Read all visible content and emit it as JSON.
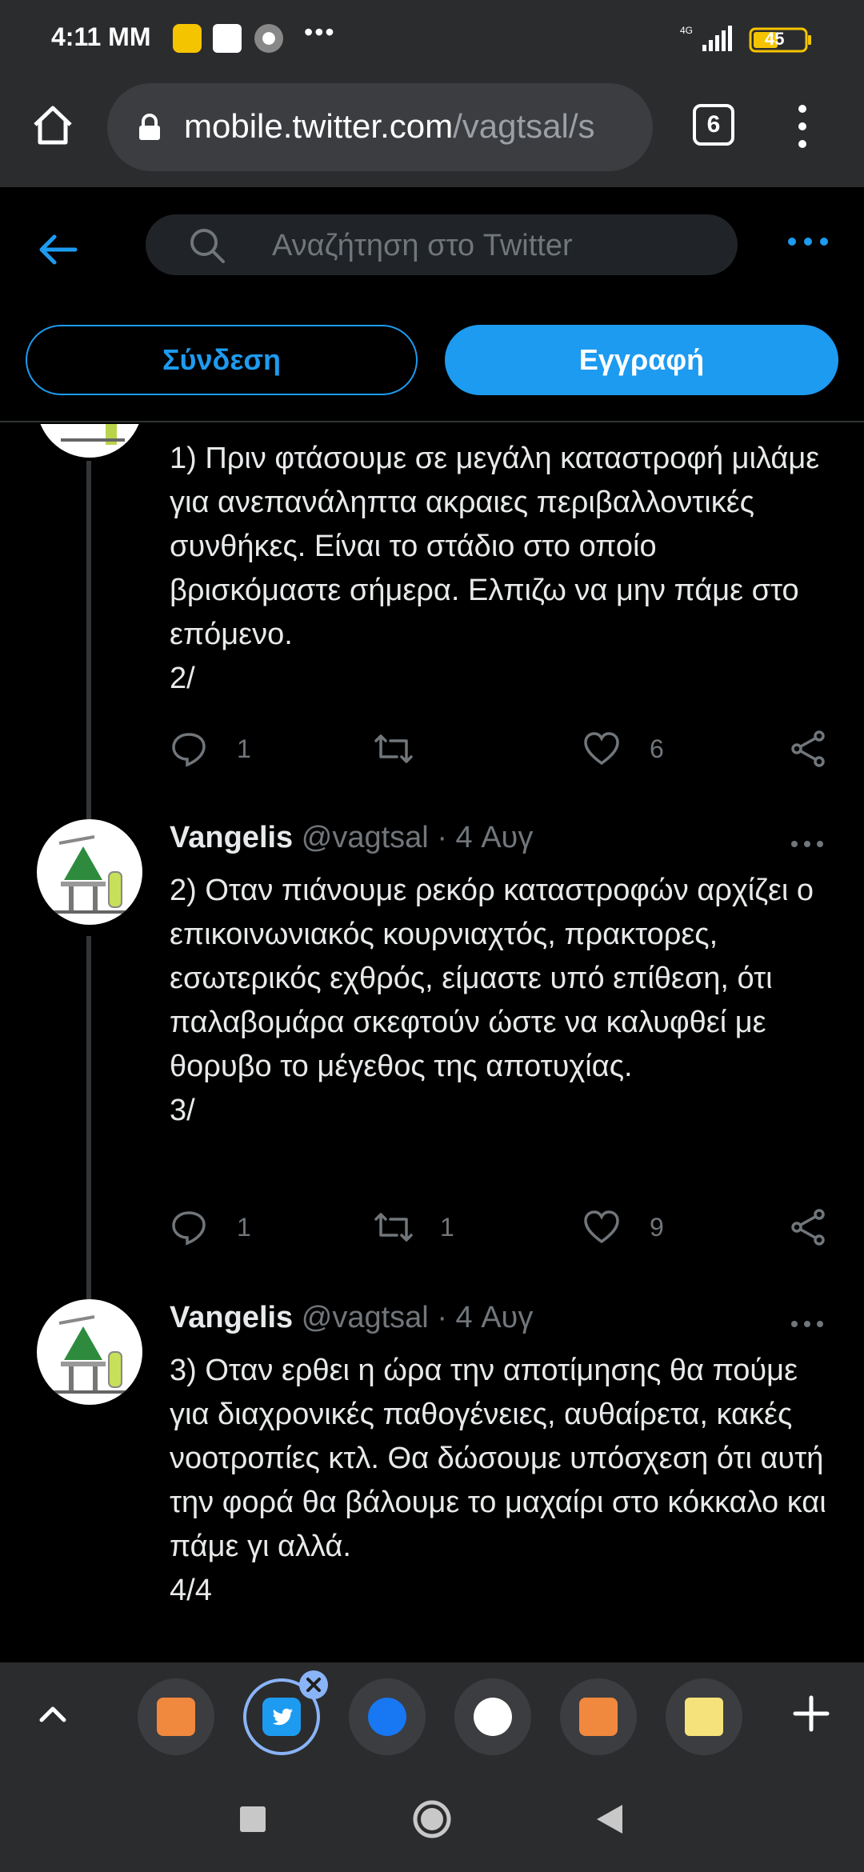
{
  "status_bar": {
    "time": "4:11 ΜΜ",
    "battery": "45",
    "network": "4G"
  },
  "browser": {
    "url_host": "mobile.twitter.com",
    "url_path": "/vagtsal/s",
    "tab_count": "6"
  },
  "twitter_header": {
    "search_placeholder": "Αναζήτηση στο Twitter",
    "login_label": "Σύνδεση",
    "signup_label": "Εγγραφή",
    "accent_color": "#1d9bf0"
  },
  "tweets": [
    {
      "text": "1) Πριν φτάσουμε σε μεγάλη καταστροφή μιλάμε για ανεπανάληπτα ακραιες περιβαλλοντικές συνθήκες. Είναι το στάδιο στο οποίο βρισκόμαστε σήμερα. Ελπιζω να μην πάμε στο επόμενο.\n2/",
      "replies": "1",
      "retweets": "",
      "likes": "6"
    },
    {
      "name": "Vangelis",
      "handle": "@vagtsal",
      "date": "· 4 Αυγ",
      "text": "2) Οταν πιάνουμε ρεκόρ καταστροφών αρχίζει ο επικοινωνιακός κουρνιαχτός, πρακτορες, εσωτερικός εχθρός, είμαστε υπό επίθεση, ότι παλαβομάρα σκεφτούν ώστε να καλυφθεί με θορυβο το μέγεθος της αποτυχίας.\n3/",
      "replies": "1",
      "retweets": "1",
      "likes": "9"
    },
    {
      "name": "Vangelis",
      "handle": "@vagtsal",
      "date": "· 4 Αυγ",
      "text": "3) Οταν ερθει η ώρα την αποτίμησης θα πούμε για διαχρονικές παθογένειες, αυθαίρετα, κακές νοοτροπίες κτλ. Θα δώσουμε υπόσχεση ότι αυτή την φορά θα βάλουμε το μαχαίρι στο κόκκαλο και πάμε γι αλλά.\n4/4"
    }
  ],
  "tab_strip": {
    "tabs": [
      {
        "icon": "ph-icon",
        "color": "#f0883e"
      },
      {
        "icon": "twitter-icon",
        "color": "#1d9bf0"
      },
      {
        "icon": "facebook-icon",
        "color": "#1877f2"
      },
      {
        "icon": "wikipedia-icon",
        "color": "#ffffff"
      },
      {
        "icon": "ph-icon",
        "color": "#f0883e"
      },
      {
        "icon": "wikipedia-icon",
        "color": "#f6e27a"
      }
    ]
  }
}
